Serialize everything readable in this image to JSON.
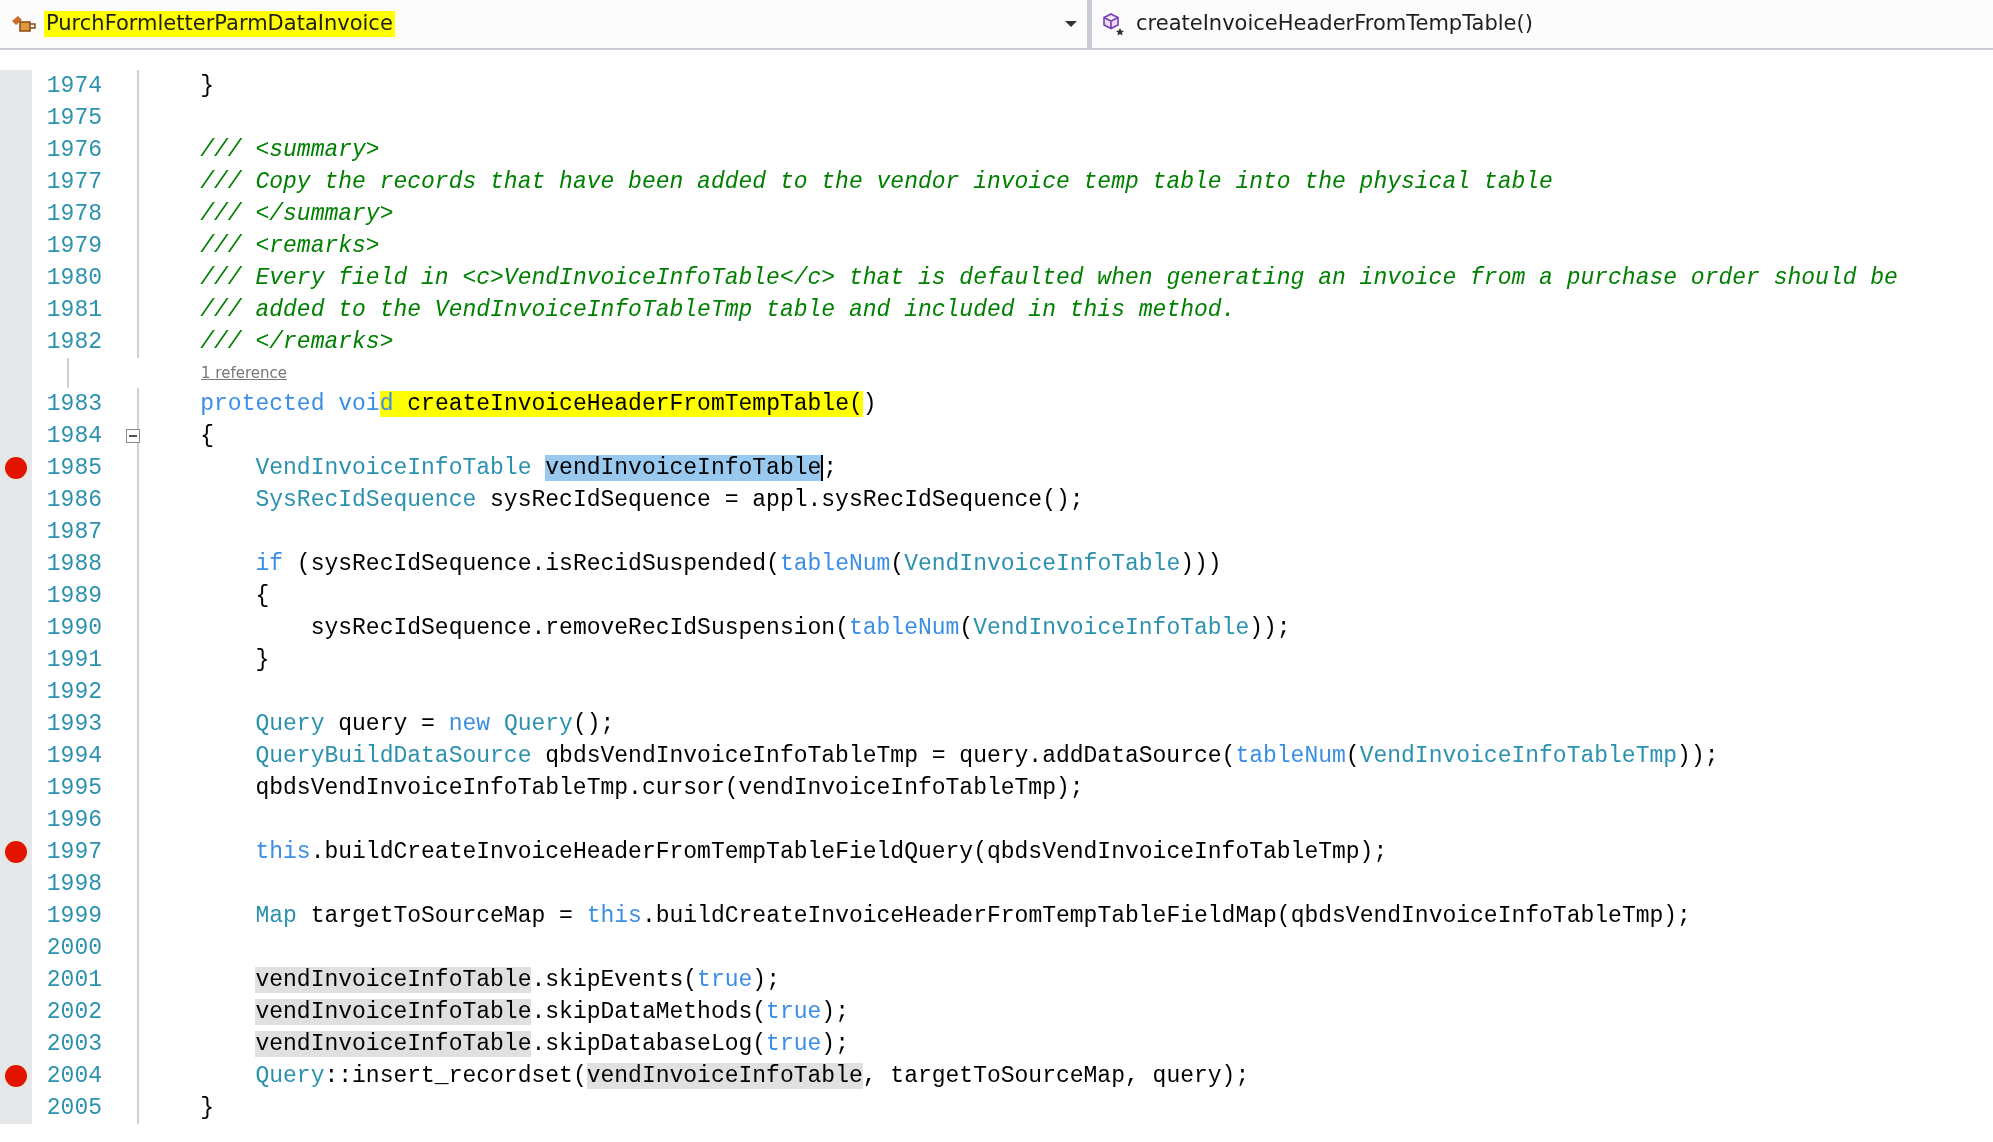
{
  "navigation_bar": {
    "class_dropdown": {
      "text": "PurchFormletterParmDataInvoice",
      "highlighted": true
    },
    "member_dropdown": {
      "text": "createInvoiceHeaderFromTempTable()",
      "highlighted": false
    }
  },
  "editor": {
    "lines": [
      {
        "number": "1974",
        "breakpoint": false,
        "segments": [
          {
            "kind": "plain",
            "text": "    }"
          }
        ]
      },
      {
        "number": "1975",
        "breakpoint": false
      },
      {
        "number": "1976",
        "breakpoint": false,
        "segments": [
          {
            "kind": "comment",
            "text": "    /// <summary>"
          }
        ]
      },
      {
        "number": "1977",
        "breakpoint": false,
        "segments": [
          {
            "kind": "comment",
            "text": "    /// Copy the records that have been added to the vendor invoice temp table into the physical table"
          }
        ]
      },
      {
        "number": "1978",
        "breakpoint": false,
        "segments": [
          {
            "kind": "comment",
            "text": "    /// </summary>"
          }
        ]
      },
      {
        "number": "1979",
        "breakpoint": false,
        "segments": [
          {
            "kind": "comment",
            "text": "    /// <remarks>"
          }
        ]
      },
      {
        "number": "1980",
        "breakpoint": false,
        "segments": [
          {
            "kind": "comment",
            "text": "    /// Every field in <c>VendInvoiceInfoTable</c> that is defaulted when generating an invoice from a purchase order should be"
          }
        ]
      },
      {
        "number": "1981",
        "breakpoint": false,
        "segments": [
          {
            "kind": "comment",
            "text": "    /// added to the VendInvoiceInfoTableTmp table and included in this method."
          }
        ]
      },
      {
        "number": "1982",
        "breakpoint": false,
        "segments": [
          {
            "kind": "comment",
            "text": "    /// </remarks>"
          }
        ],
        "code_lens": "1 reference"
      },
      {
        "number": "1983",
        "breakpoint": false,
        "segments": [
          {
            "kind": "keyword",
            "text": "    protected voi"
          },
          {
            "kind": "keyword",
            "text": "d",
            "marker_highlight": true
          },
          {
            "kind": "plain",
            "text": " createInvoiceHeaderFromTempTable(",
            "marker_highlight": true
          },
          {
            "kind": "plain",
            "text": ")"
          }
        ]
      },
      {
        "number": "1984",
        "breakpoint": false,
        "fold_box": true,
        "segments": [
          {
            "kind": "plain",
            "text": "    {"
          }
        ]
      },
      {
        "number": "1985",
        "breakpoint": true,
        "segments": [
          {
            "kind": "type",
            "text": "        VendInvoiceInfoTable "
          },
          {
            "kind": "plain",
            "text": "vendInvoiceInfoTable",
            "text_selected": true
          },
          {
            "kind": "plain",
            "text": ";"
          }
        ]
      },
      {
        "number": "1986",
        "breakpoint": false,
        "segments": [
          {
            "kind": "type",
            "text": "        SysRecIdSequence"
          },
          {
            "kind": "plain",
            "text": " sysRecIdSequence = appl.sysRecIdSequence();"
          }
        ]
      },
      {
        "number": "1987",
        "breakpoint": false
      },
      {
        "number": "1988",
        "breakpoint": false,
        "segments": [
          {
            "kind": "keyword",
            "text": "        if"
          },
          {
            "kind": "plain",
            "text": " (sysRecIdSequence.isRecidSuspended("
          },
          {
            "kind": "keyword",
            "text": "tableNum"
          },
          {
            "kind": "plain",
            "text": "("
          },
          {
            "kind": "type",
            "text": "VendInvoiceInfoTable"
          },
          {
            "kind": "plain",
            "text": ")))"
          }
        ]
      },
      {
        "number": "1989",
        "breakpoint": false,
        "segments": [
          {
            "kind": "plain",
            "text": "        {"
          }
        ]
      },
      {
        "number": "1990",
        "breakpoint": false,
        "segments": [
          {
            "kind": "plain",
            "text": "            sysRecIdSequence.removeRecIdSuspension("
          },
          {
            "kind": "keyword",
            "text": "tableNum"
          },
          {
            "kind": "plain",
            "text": "("
          },
          {
            "kind": "type",
            "text": "VendInvoiceInfoTable"
          },
          {
            "kind": "plain",
            "text": "));"
          }
        ]
      },
      {
        "number": "1991",
        "breakpoint": false,
        "segments": [
          {
            "kind": "plain",
            "text": "        }"
          }
        ]
      },
      {
        "number": "1992",
        "breakpoint": false
      },
      {
        "number": "1993",
        "breakpoint": false,
        "segments": [
          {
            "kind": "type",
            "text": "        Query"
          },
          {
            "kind": "plain",
            "text": " query = "
          },
          {
            "kind": "keyword",
            "text": "new"
          },
          {
            "kind": "type",
            "text": " Query"
          },
          {
            "kind": "plain",
            "text": "();"
          }
        ]
      },
      {
        "number": "1994",
        "breakpoint": false,
        "segments": [
          {
            "kind": "type",
            "text": "        QueryBuildDataSource"
          },
          {
            "kind": "plain",
            "text": " qbdsVendInvoiceInfoTableTmp = query.addDataSource("
          },
          {
            "kind": "keyword",
            "text": "tableNum"
          },
          {
            "kind": "plain",
            "text": "("
          },
          {
            "kind": "type",
            "text": "VendInvoiceInfoTableTmp"
          },
          {
            "kind": "plain",
            "text": "));"
          }
        ]
      },
      {
        "number": "1995",
        "breakpoint": false,
        "segments": [
          {
            "kind": "plain",
            "text": "        qbdsVendInvoiceInfoTableTmp.cursor(vendInvoiceInfoTableTmp);"
          }
        ]
      },
      {
        "number": "1996",
        "breakpoint": false
      },
      {
        "number": "1997",
        "breakpoint": true,
        "segments": [
          {
            "kind": "keyword",
            "text": "        this"
          },
          {
            "kind": "plain",
            "text": ".buildCreateInvoiceHeaderFromTempTableFieldQuery(qbdsVendInvoiceInfoTableTmp);"
          }
        ]
      },
      {
        "number": "1998",
        "breakpoint": false
      },
      {
        "number": "1999",
        "breakpoint": false,
        "segments": [
          {
            "kind": "type",
            "text": "        Map"
          },
          {
            "kind": "plain",
            "text": " targetToSourceMap = "
          },
          {
            "kind": "keyword",
            "text": "this"
          },
          {
            "kind": "plain",
            "text": ".buildCreateInvoiceHeaderFromTempTableFieldMap(qbdsVendInvoiceInfoTableTmp);"
          }
        ]
      },
      {
        "number": "2000",
        "breakpoint": false
      },
      {
        "number": "2001",
        "breakpoint": false,
        "segments": [
          {
            "kind": "plain",
            "text": "        vendInvoiceInfoTable",
            "reference_highlight": true
          },
          {
            "kind": "plain",
            "text": ".skipEvents("
          },
          {
            "kind": "keyword",
            "text": "true"
          },
          {
            "kind": "plain",
            "text": ");"
          }
        ]
      },
      {
        "number": "2002",
        "breakpoint": false,
        "segments": [
          {
            "kind": "plain",
            "text": "        vendInvoiceInfoTable",
            "reference_highlight": true
          },
          {
            "kind": "plain",
            "text": ".skipDataMethods("
          },
          {
            "kind": "keyword",
            "text": "true"
          },
          {
            "kind": "plain",
            "text": ");"
          }
        ]
      },
      {
        "number": "2003",
        "breakpoint": false,
        "segments": [
          {
            "kind": "plain",
            "text": "        vendInvoiceInfoTable",
            "reference_highlight": true
          },
          {
            "kind": "plain",
            "text": ".skipDatabaseLog("
          },
          {
            "kind": "keyword",
            "text": "true"
          },
          {
            "kind": "plain",
            "text": ");"
          }
        ]
      },
      {
        "number": "2004",
        "breakpoint": true,
        "segments": [
          {
            "kind": "type",
            "text": "        Query"
          },
          {
            "kind": "plain",
            "text": "::insert_recordset("
          },
          {
            "kind": "plain",
            "text": "vendInvoiceInfoTable",
            "reference_highlight": true
          },
          {
            "kind": "plain",
            "text": ", targetToSourceMap, query);"
          }
        ]
      },
      {
        "number": "2005",
        "breakpoint": false,
        "segments": [
          {
            "kind": "plain",
            "text": "    }"
          }
        ]
      }
    ]
  }
}
